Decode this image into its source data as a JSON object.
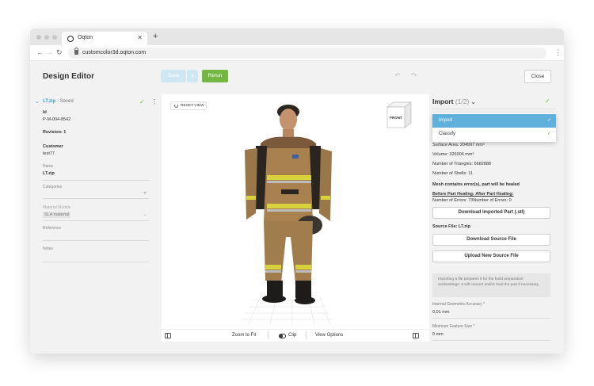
{
  "browser": {
    "tab_title": "Oqton",
    "tab_close": "✕",
    "new_tab": "+",
    "url": "customcolor3d.oqton.com"
  },
  "header": {
    "title": "Design Editor",
    "save_label": "Save",
    "rerun_label": "Rerun",
    "close_label": "Close"
  },
  "file": {
    "name": "LT.zip",
    "status": "- Saved"
  },
  "details": {
    "id_label": "Id",
    "id_value": "P-M-004-8542",
    "revision": "Revision: 1",
    "customer_label": "Customer",
    "customer_value": "test77",
    "name_label": "Name",
    "name_value": "LT.zip",
    "categories_label": "Categories",
    "material_label": "Material Models",
    "material_value": "SLA material",
    "reference_label": "Reference",
    "notes_label": "Notes"
  },
  "viewport": {
    "reset_label": "RESET VIEW",
    "cube_face": "FRONT",
    "zoom_label": "Zoom to Fit",
    "clip_label": "Clip",
    "view_options_label": "View Options"
  },
  "import_panel": {
    "title": "Import",
    "step": "(1/2)",
    "options": [
      {
        "label": "Import",
        "selected": true
      },
      {
        "label": "Classify",
        "selected": false
      }
    ],
    "surface_area": "Surface Area: 204997 mm²",
    "volume": "Volume: 326006 mm³",
    "triangles": "Number of Triangles: 6682888",
    "shells": "Number of Shells: 11",
    "mesh_error": "Mesh contains error(s), part will be healed",
    "healing_link": "Before Part Healing: After Part Healing:",
    "errors": "Number of Errors: 73Number of Errors: 0",
    "download_imported": "Download Imported Part (.stl)",
    "source_file": "Source File: LT.zip",
    "download_source": "Download Source File",
    "upload_source": "Upload New Source File",
    "note": "Importing a file prepares it for the build preparation worksettings. It will convert and/or heal the part if necessary.",
    "accuracy_label": "Internal Geometric Accuracy *",
    "accuracy_value": "0,01 mm",
    "feature_label": "Minimum Feature Size *",
    "feature_value": "0 mm",
    "badge_a": "0",
    "badge_b": "0",
    "terminal": ">_"
  },
  "colors": {
    "accent_blue": "#3aa0d8",
    "green": "#74b843",
    "orange": "#f5a623"
  }
}
